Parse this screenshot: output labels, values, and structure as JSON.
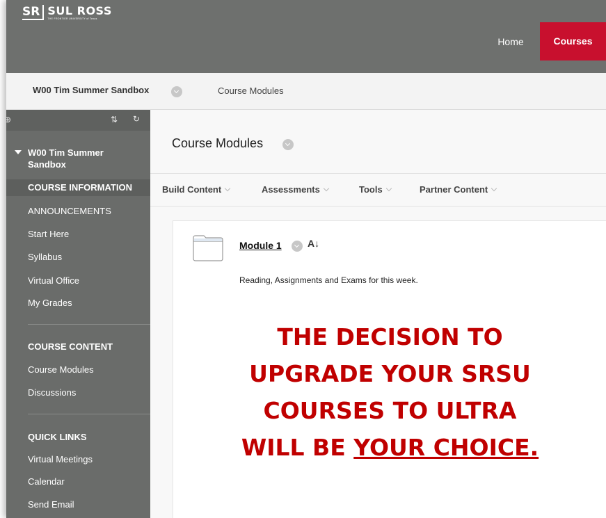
{
  "brand": {
    "mark": "SR",
    "name": "SUL ROSS",
    "tagline": "THE FRONTIER UNIVERSITY of Texas"
  },
  "top_nav": {
    "home": "Home",
    "courses": "Courses"
  },
  "breadcrumb": {
    "course": "W00 Tim Summer Sandbox",
    "page": "Course Modules"
  },
  "sidebar": {
    "course_title": "W00 Tim Summer Sandbox",
    "sections": [
      {
        "heading": "COURSE INFORMATION",
        "items": [
          "ANNOUNCEMENTS",
          "Start Here",
          "Syllabus",
          "Virtual Office",
          "My Grades"
        ]
      },
      {
        "heading": "COURSE CONTENT",
        "items": [
          "Course Modules",
          "Discussions"
        ]
      },
      {
        "heading": "QUICK LINKS",
        "items": [
          "Virtual Meetings",
          "Calendar",
          "Send Email"
        ]
      }
    ]
  },
  "main": {
    "title": "Course Modules",
    "actions": [
      "Build Content",
      "Assessments",
      "Tools",
      "Partner Content"
    ],
    "module": {
      "title": "Module 1",
      "description": "Reading, Assignments and Exams for this week."
    }
  },
  "overlay": {
    "line1": "THE DECISION TO",
    "line2": "UPGRADE YOUR SRSU",
    "line3": "COURSES TO ULTRA",
    "line4_prefix": "WILL BE ",
    "line4_underlined": "YOUR CHOICE."
  },
  "colors": {
    "accent": "#c8102e",
    "overlay_text": "#c00000",
    "topbar": "#6e706e",
    "sidebar": "#6a6c6a"
  }
}
